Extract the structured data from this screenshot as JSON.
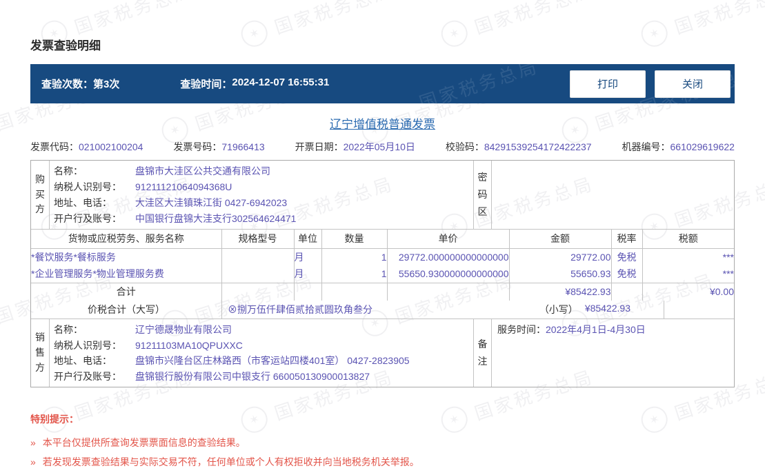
{
  "watermark": {
    "text": "国家税务总局",
    "emblem": "✶"
  },
  "page": {
    "title": "发票查验明细"
  },
  "query_bar": {
    "count_label": "查验次数：",
    "count_value": "第3次",
    "time_label": "查验时间：",
    "time_value": "2024-12-07 16:55:31",
    "print_label": "打印",
    "close_label": "关闭"
  },
  "invoice": {
    "title": "辽宁增值税普通发票",
    "meta": [
      {
        "label": "发票代码：",
        "value": "021002100204"
      },
      {
        "label": "发票号码：",
        "value": "71966413"
      },
      {
        "label": "开票日期：",
        "value": "2022年05月10日"
      },
      {
        "label": "校验码：",
        "value": "84291539254172422237"
      },
      {
        "label": "机器编号：",
        "value": "661029619622"
      }
    ],
    "buyer": {
      "side_label": "购买方",
      "rows": [
        {
          "label": "名称：",
          "value": "盘锦市大洼区公共交通有限公司"
        },
        {
          "label": "纳税人识别号：",
          "value": "91211121064094368U"
        },
        {
          "label": "地址、电话：",
          "value": "大洼区大洼镇珠江街 0427-6942023"
        },
        {
          "label": "开户行及账号：",
          "value": "中国银行盘锦大洼支行302564624471"
        }
      ],
      "password_area_label": "密码区"
    },
    "items_table": {
      "headers": [
        "货物或应税劳务、服务名称",
        "规格型号",
        "单位",
        "数量",
        "单价",
        "金额",
        "税率",
        "税额"
      ],
      "rows": [
        {
          "name": "*餐饮服务*餐标服务",
          "spec": "",
          "unit": "月",
          "qty": "1",
          "price": "29772.000000000000000",
          "amount": "29772.00",
          "tax_rate": "免税",
          "tax": "***"
        },
        {
          "name": "*企业管理服务*物业管理服务费",
          "spec": "",
          "unit": "月",
          "qty": "1",
          "price": "55650.930000000000000",
          "amount": "55650.93",
          "tax_rate": "免税",
          "tax": "***"
        }
      ],
      "total": {
        "label": "合计",
        "amount": "¥85422.93",
        "tax": "¥0.00"
      }
    },
    "grand_total": {
      "label": "价税合计（大写）",
      "uppercase": "⊗捌万伍仟肆佰贰拾贰圆玖角叁分",
      "lowercase_label": "（小写）",
      "lowercase_value": "¥85422.93"
    },
    "seller": {
      "side_label": "销售方",
      "rows": [
        {
          "label": "名称：",
          "value": "辽宁德晟物业有限公司"
        },
        {
          "label": "纳税人识别号：",
          "value": "91211103MA10QPUXXC"
        },
        {
          "label": "地址、电话：",
          "value": "盘锦市兴隆台区庄林路西（市客运站四楼401室） 0427-2823905"
        },
        {
          "label": "开户行及账号：",
          "value": "盘锦银行股份有限公司中银支行 660050130900013827"
        }
      ],
      "remark_label": "备注",
      "remark": {
        "label": "服务时间：",
        "value": "2022年4月1日-4月30日"
      }
    }
  },
  "notice": {
    "title": "特别提示：",
    "bullet": "»",
    "items": [
      "本平台仅提供所查询发票票面信息的查验结果。",
      "若发现发票查验结果与实际交易不符，任何单位或个人有权拒收并向当地税务机关举报。"
    ]
  }
}
